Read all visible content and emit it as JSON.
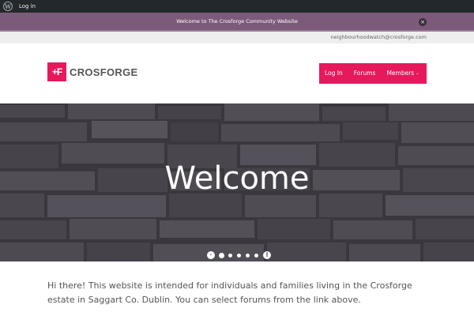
{
  "adminbar": {
    "logo_icon": "wordpress-icon",
    "login_label": "Log in"
  },
  "notice": {
    "message": "Welcome to The Crosforge Community Website",
    "close_icon": "close-icon",
    "close_glyph": "×"
  },
  "contact": {
    "email": "neighbourhoodwatch@crosforge.com"
  },
  "header": {
    "logo_mark": "+F",
    "logo_text": "CROSFORGE",
    "brand_color": "#e6195c"
  },
  "nav": {
    "items": [
      {
        "label": "Log In"
      },
      {
        "label": "Forums"
      },
      {
        "label": "Members",
        "has_dropdown": true
      }
    ],
    "chevron_glyph": "⌄"
  },
  "hero": {
    "title": "Welcome",
    "slides_count": 5,
    "active_slide": 1,
    "prev_glyph": "‹",
    "next_glyph": "‖"
  },
  "intro": {
    "text": "Hi there! This website is intended for individuals and families living in the Crosforge estate in Saggart Co. Dublin. You can select forums from the link above."
  }
}
